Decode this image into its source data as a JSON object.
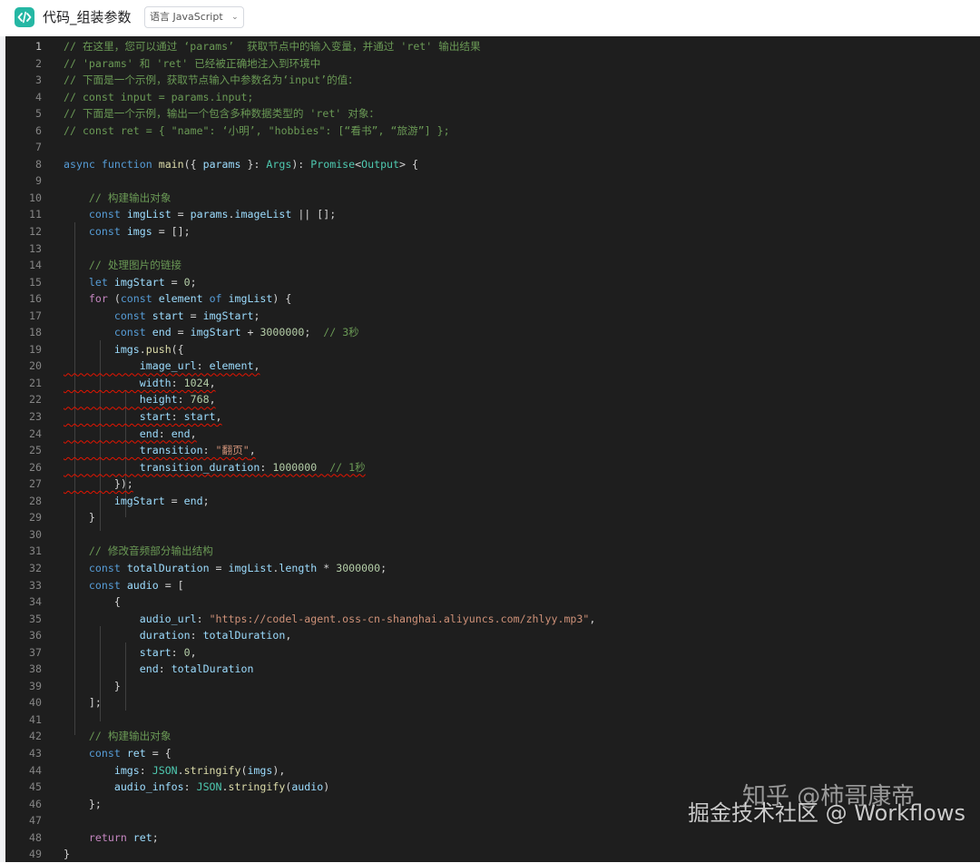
{
  "header": {
    "title": "代码_组装参数",
    "language_select": "语言 JavaScript",
    "icon": "code-brackets-icon"
  },
  "editor": {
    "lines": [
      {
        "n": "1",
        "tokens": [
          [
            "comment",
            "// 在这里，您可以通过 ‘params’  获取节点中的输入变量，并通过 'ret' 输出结果"
          ]
        ]
      },
      {
        "n": "2",
        "tokens": [
          [
            "comment",
            "// 'params' 和 'ret' 已经被正确地注入到环境中"
          ]
        ]
      },
      {
        "n": "3",
        "tokens": [
          [
            "comment",
            "// 下面是一个示例，获取节点输入中参数名为‘input’的值："
          ]
        ]
      },
      {
        "n": "4",
        "tokens": [
          [
            "comment",
            "// const input = params.input;"
          ]
        ]
      },
      {
        "n": "5",
        "tokens": [
          [
            "comment",
            "// 下面是一个示例，输出一个包含多种数据类型的 'ret' 对象："
          ]
        ]
      },
      {
        "n": "6",
        "tokens": [
          [
            "comment",
            "// const ret = { \"name\": ‘小明’, \"hobbies\": [“看书”, “旅游”] };"
          ]
        ]
      },
      {
        "n": "7",
        "tokens": []
      },
      {
        "n": "8",
        "tokens": [
          [
            "kw",
            "async "
          ],
          [
            "kw",
            "function "
          ],
          [
            "fn",
            "main"
          ],
          [
            "plain",
            "({ "
          ],
          [
            "var",
            "params"
          ],
          [
            "plain",
            " }: "
          ],
          [
            "type",
            "Args"
          ],
          [
            "plain",
            "): "
          ],
          [
            "type",
            "Promise"
          ],
          [
            "plain",
            "<"
          ],
          [
            "type",
            "Output"
          ],
          [
            "plain",
            "> {"
          ]
        ]
      },
      {
        "n": "9",
        "tokens": []
      },
      {
        "n": "10",
        "tokens": [
          [
            "plain",
            "    "
          ],
          [
            "comment",
            "// 构建输出对象"
          ]
        ]
      },
      {
        "n": "11",
        "tokens": [
          [
            "plain",
            "    "
          ],
          [
            "kw",
            "const "
          ],
          [
            "var",
            "imgList"
          ],
          [
            "plain",
            " = "
          ],
          [
            "var",
            "params"
          ],
          [
            "plain",
            "."
          ],
          [
            "var",
            "imageList"
          ],
          [
            "plain",
            " || [];"
          ]
        ]
      },
      {
        "n": "12",
        "tokens": [
          [
            "plain",
            "    "
          ],
          [
            "kw",
            "const "
          ],
          [
            "var",
            "imgs"
          ],
          [
            "plain",
            " = [];"
          ]
        ]
      },
      {
        "n": "13",
        "tokens": []
      },
      {
        "n": "14",
        "tokens": [
          [
            "plain",
            "    "
          ],
          [
            "comment",
            "// 处理图片的链接"
          ]
        ]
      },
      {
        "n": "15",
        "tokens": [
          [
            "plain",
            "    "
          ],
          [
            "kw",
            "let "
          ],
          [
            "var",
            "imgStart"
          ],
          [
            "plain",
            " = "
          ],
          [
            "num",
            "0"
          ],
          [
            "plain",
            ";"
          ]
        ]
      },
      {
        "n": "16",
        "tokens": [
          [
            "plain",
            "    "
          ],
          [
            "ctrl",
            "for "
          ],
          [
            "plain",
            "("
          ],
          [
            "kw",
            "const "
          ],
          [
            "var",
            "element "
          ],
          [
            "kw",
            "of "
          ],
          [
            "var",
            "imgList"
          ],
          [
            "plain",
            ") {"
          ]
        ]
      },
      {
        "n": "17",
        "tokens": [
          [
            "plain",
            "        "
          ],
          [
            "kw",
            "const "
          ],
          [
            "var",
            "start"
          ],
          [
            "plain",
            " = "
          ],
          [
            "var",
            "imgStart"
          ],
          [
            "plain",
            ";"
          ]
        ]
      },
      {
        "n": "18",
        "tokens": [
          [
            "plain",
            "        "
          ],
          [
            "kw",
            "const "
          ],
          [
            "var",
            "end"
          ],
          [
            "plain",
            " = "
          ],
          [
            "var",
            "imgStart"
          ],
          [
            "plain",
            " + "
          ],
          [
            "num",
            "3000000"
          ],
          [
            "plain",
            ";  "
          ],
          [
            "comment",
            "// 3秒"
          ]
        ]
      },
      {
        "n": "19",
        "tokens": [
          [
            "plain",
            "        "
          ],
          [
            "var",
            "imgs"
          ],
          [
            "plain",
            "."
          ],
          [
            "fn",
            "push"
          ],
          [
            "plain",
            "({"
          ]
        ]
      },
      {
        "n": "20",
        "tokens": [
          [
            "plain",
            "            "
          ],
          [
            "var",
            "image_url"
          ],
          [
            "plain",
            ": "
          ],
          [
            "var",
            "element"
          ],
          [
            "plain",
            ","
          ]
        ],
        "squiggle": true
      },
      {
        "n": "21",
        "tokens": [
          [
            "plain",
            "            "
          ],
          [
            "var",
            "width"
          ],
          [
            "plain",
            ": "
          ],
          [
            "num",
            "1024"
          ],
          [
            "plain",
            ","
          ]
        ],
        "squiggle": true
      },
      {
        "n": "22",
        "tokens": [
          [
            "plain",
            "            "
          ],
          [
            "var",
            "height"
          ],
          [
            "plain",
            ": "
          ],
          [
            "num",
            "768"
          ],
          [
            "plain",
            ","
          ]
        ],
        "squiggle": true
      },
      {
        "n": "23",
        "tokens": [
          [
            "plain",
            "            "
          ],
          [
            "var",
            "start"
          ],
          [
            "plain",
            ": "
          ],
          [
            "var",
            "start"
          ],
          [
            "plain",
            ","
          ]
        ],
        "squiggle": true
      },
      {
        "n": "24",
        "tokens": [
          [
            "plain",
            "            "
          ],
          [
            "var",
            "end"
          ],
          [
            "plain",
            ": "
          ],
          [
            "var",
            "end"
          ],
          [
            "plain",
            ","
          ]
        ],
        "squiggle": true
      },
      {
        "n": "25",
        "tokens": [
          [
            "plain",
            "            "
          ],
          [
            "var",
            "transition"
          ],
          [
            "plain",
            ": "
          ],
          [
            "str",
            "\"翻页\""
          ],
          [
            "plain",
            ","
          ]
        ],
        "squiggle": true
      },
      {
        "n": "26",
        "tokens": [
          [
            "plain",
            "            "
          ],
          [
            "var",
            "transition_duration"
          ],
          [
            "plain",
            ": "
          ],
          [
            "num",
            "1000000"
          ],
          [
            "plain",
            "  "
          ],
          [
            "comment",
            "// 1秒"
          ]
        ],
        "squiggle": true
      },
      {
        "n": "27",
        "tokens": [
          [
            "plain",
            "        "
          ],
          [
            "plain",
            "});"
          ]
        ],
        "squiggle": true
      },
      {
        "n": "28",
        "tokens": [
          [
            "plain",
            "        "
          ],
          [
            "var",
            "imgStart"
          ],
          [
            "plain",
            " = "
          ],
          [
            "var",
            "end"
          ],
          [
            "plain",
            ";"
          ]
        ]
      },
      {
        "n": "29",
        "tokens": [
          [
            "plain",
            "    }"
          ]
        ]
      },
      {
        "n": "30",
        "tokens": []
      },
      {
        "n": "31",
        "tokens": [
          [
            "plain",
            "    "
          ],
          [
            "comment",
            "// 修改音频部分输出结构"
          ]
        ]
      },
      {
        "n": "32",
        "tokens": [
          [
            "plain",
            "    "
          ],
          [
            "kw",
            "const "
          ],
          [
            "var",
            "totalDuration"
          ],
          [
            "plain",
            " = "
          ],
          [
            "var",
            "imgList"
          ],
          [
            "plain",
            "."
          ],
          [
            "var",
            "length"
          ],
          [
            "plain",
            " * "
          ],
          [
            "num",
            "3000000"
          ],
          [
            "plain",
            ";"
          ]
        ]
      },
      {
        "n": "33",
        "tokens": [
          [
            "plain",
            "    "
          ],
          [
            "kw",
            "const "
          ],
          [
            "var",
            "audio"
          ],
          [
            "plain",
            " = ["
          ]
        ]
      },
      {
        "n": "34",
        "tokens": [
          [
            "plain",
            "        {"
          ]
        ]
      },
      {
        "n": "35",
        "tokens": [
          [
            "plain",
            "            "
          ],
          [
            "var",
            "audio_url"
          ],
          [
            "plain",
            ": "
          ],
          [
            "str",
            "\"https://codel-agent.oss-cn-shanghai.aliyuncs.com/zhlyy.mp3\""
          ],
          [
            "plain",
            ","
          ]
        ]
      },
      {
        "n": "36",
        "tokens": [
          [
            "plain",
            "            "
          ],
          [
            "var",
            "duration"
          ],
          [
            "plain",
            ": "
          ],
          [
            "var",
            "totalDuration"
          ],
          [
            "plain",
            ","
          ]
        ]
      },
      {
        "n": "37",
        "tokens": [
          [
            "plain",
            "            "
          ],
          [
            "var",
            "start"
          ],
          [
            "plain",
            ": "
          ],
          [
            "num",
            "0"
          ],
          [
            "plain",
            ","
          ]
        ]
      },
      {
        "n": "38",
        "tokens": [
          [
            "plain",
            "            "
          ],
          [
            "var",
            "end"
          ],
          [
            "plain",
            ": "
          ],
          [
            "var",
            "totalDuration"
          ]
        ]
      },
      {
        "n": "39",
        "tokens": [
          [
            "plain",
            "        }"
          ]
        ]
      },
      {
        "n": "40",
        "tokens": [
          [
            "plain",
            "    ];"
          ]
        ]
      },
      {
        "n": "41",
        "tokens": []
      },
      {
        "n": "42",
        "tokens": [
          [
            "plain",
            "    "
          ],
          [
            "comment",
            "// 构建输出对象"
          ]
        ]
      },
      {
        "n": "43",
        "tokens": [
          [
            "plain",
            "    "
          ],
          [
            "kw",
            "const "
          ],
          [
            "var",
            "ret"
          ],
          [
            "plain",
            " = {"
          ]
        ]
      },
      {
        "n": "44",
        "tokens": [
          [
            "plain",
            "        "
          ],
          [
            "var",
            "imgs"
          ],
          [
            "plain",
            ": "
          ],
          [
            "type",
            "JSON"
          ],
          [
            "plain",
            "."
          ],
          [
            "fn",
            "stringify"
          ],
          [
            "plain",
            "("
          ],
          [
            "var",
            "imgs"
          ],
          [
            "plain",
            "),"
          ]
        ]
      },
      {
        "n": "45",
        "tokens": [
          [
            "plain",
            "        "
          ],
          [
            "var",
            "audio_infos"
          ],
          [
            "plain",
            ": "
          ],
          [
            "type",
            "JSON"
          ],
          [
            "plain",
            "."
          ],
          [
            "fn",
            "stringify"
          ],
          [
            "plain",
            "("
          ],
          [
            "var",
            "audio"
          ],
          [
            "plain",
            ")"
          ]
        ]
      },
      {
        "n": "46",
        "tokens": [
          [
            "plain",
            "    };"
          ]
        ]
      },
      {
        "n": "47",
        "tokens": []
      },
      {
        "n": "48",
        "tokens": [
          [
            "plain",
            "    "
          ],
          [
            "ctrl",
            "return "
          ],
          [
            "var",
            "ret"
          ],
          [
            "plain",
            ";"
          ]
        ]
      },
      {
        "n": "49",
        "tokens": [
          [
            "plain",
            "}"
          ]
        ]
      }
    ]
  },
  "watermark": {
    "line1": "知乎 @柿哥康帝",
    "line2": "掘金技术社区 @ Workflows"
  },
  "colors": {
    "accent": "#25b7a4",
    "editor_bg": "#1e1e1e",
    "comment": "#6a9955",
    "keyword": "#569cd6",
    "string": "#ce9178",
    "number": "#b5cea8",
    "error": "#e51400"
  }
}
